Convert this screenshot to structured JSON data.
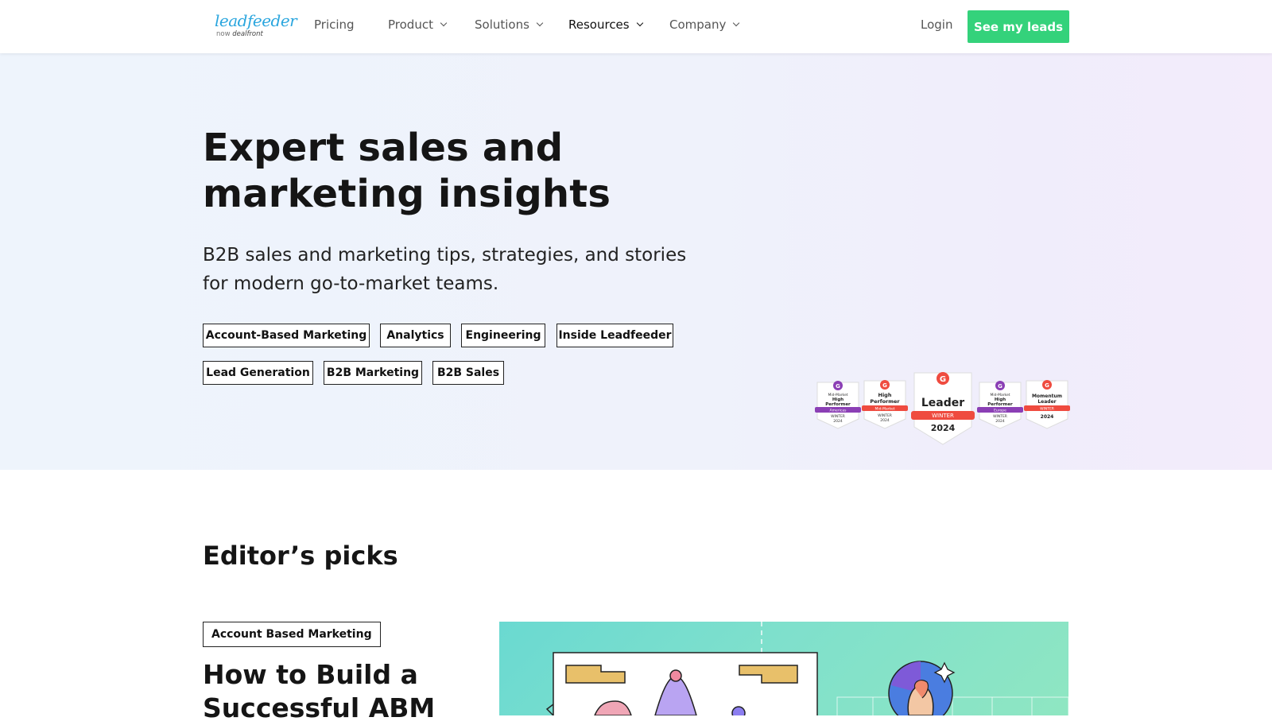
{
  "header": {
    "logo": {
      "word": "leadfeeder",
      "by": "now",
      "brand": "dealfront"
    },
    "nav": [
      {
        "label": "Pricing",
        "dropdown": false,
        "active": false
      },
      {
        "label": "Product",
        "dropdown": true,
        "active": false
      },
      {
        "label": "Solutions",
        "dropdown": true,
        "active": false
      },
      {
        "label": "Resources",
        "dropdown": true,
        "active": true
      },
      {
        "label": "Company",
        "dropdown": true,
        "active": false
      }
    ],
    "login_label": "Login",
    "cta_label": "See my leads"
  },
  "hero": {
    "title": "Expert sales and marketing insights",
    "subtitle": "B2B sales and marketing tips, strategies, and stories for modern go-to-market teams.",
    "tags": [
      "Account-Based Marketing",
      "Analytics",
      "Engineering",
      "Inside Leadfeeder",
      "Lead Generation",
      "B2B Marketing",
      "B2B Sales"
    ],
    "badges": [
      {
        "lines": [
          "Mid-Market",
          "High",
          "Performer"
        ],
        "ribbon": "Americas",
        "season": "WINTER",
        "year": "2024",
        "ribbon_color": "#8b3fb5"
      },
      {
        "lines": [
          "High",
          "Performer"
        ],
        "ribbon": "Mid-Market",
        "season": "WINTER",
        "year": "2024",
        "ribbon_color": "#ef4b3f"
      },
      {
        "lines": [
          "Leader"
        ],
        "ribbon": "WINTER",
        "season": "",
        "year": "2024",
        "ribbon_color": "#ef4b3f"
      },
      {
        "lines": [
          "Mid-Market",
          "High",
          "Performer"
        ],
        "ribbon": "Europe",
        "season": "WINTER",
        "year": "2024",
        "ribbon_color": "#8b3fb5"
      },
      {
        "lines": [
          "Momentum",
          "Leader"
        ],
        "ribbon": "WINTER",
        "season": "",
        "year": "2024",
        "ribbon_color": "#ef4b3f"
      }
    ]
  },
  "editors_picks": {
    "title": "Editor’s picks",
    "first": {
      "tag": "Account Based Marketing",
      "title": "How to Build a Successful ABM"
    }
  },
  "colors": {
    "accent_green": "#34d27b",
    "logo_blue": "#2ba6de",
    "g2_red": "#ef4b3f",
    "g2_purple": "#8b3fb5"
  }
}
